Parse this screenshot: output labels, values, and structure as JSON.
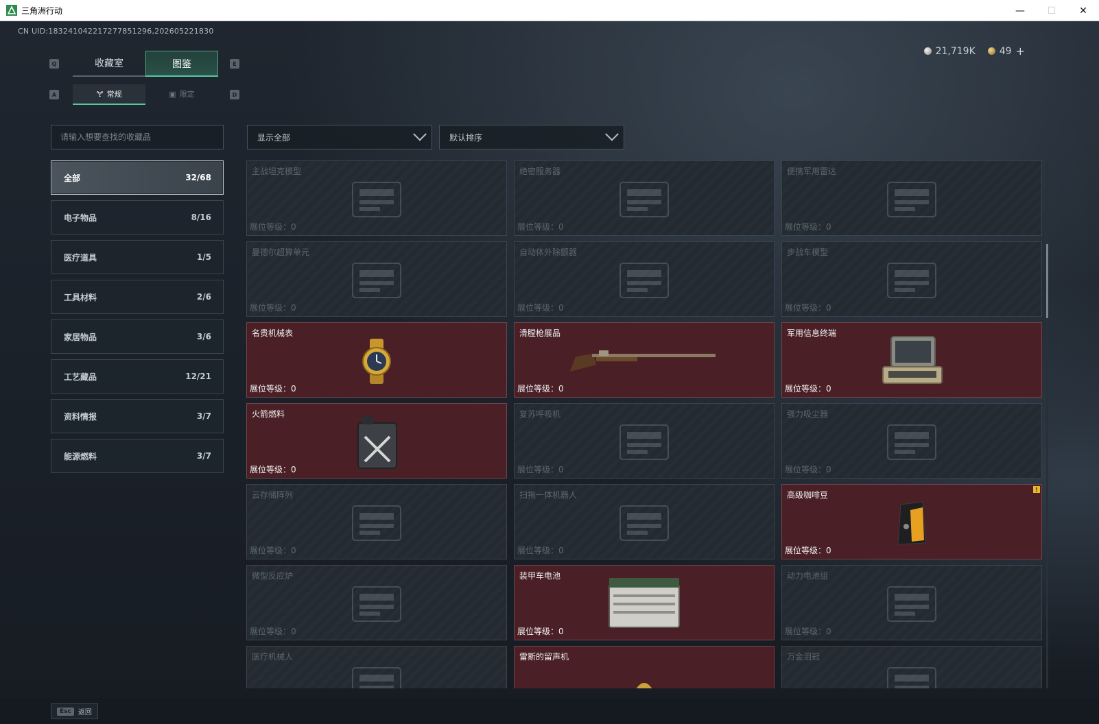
{
  "window": {
    "title": "三角洲行动",
    "minimize": "—",
    "maximize": "☐",
    "close": "✕"
  },
  "uid_text": "CN UID:183241042217277851296,202605221830",
  "currency": {
    "silver": "21,719K",
    "gold": "49",
    "plus": "+"
  },
  "keys": {
    "tab_left": "Q",
    "tab_right": "E",
    "sub_left": "A",
    "sub_right": "D"
  },
  "tabs": [
    {
      "label": "收藏室"
    },
    {
      "label": "图鉴"
    }
  ],
  "subtabs": [
    {
      "label": "常规",
      "icon": "🝖"
    },
    {
      "label": "限定",
      "icon": "▣"
    }
  ],
  "search": {
    "placeholder": "请输入想要查找的收藏品"
  },
  "filter": {
    "label": "显示全部"
  },
  "sort": {
    "label": "默认排序"
  },
  "categories": [
    {
      "label": "全部",
      "count": "32/68"
    },
    {
      "label": "电子物品",
      "count": "8/16"
    },
    {
      "label": "医疗道具",
      "count": "1/5"
    },
    {
      "label": "工具材料",
      "count": "2/6"
    },
    {
      "label": "家居物品",
      "count": "3/6"
    },
    {
      "label": "工艺藏品",
      "count": "12/21"
    },
    {
      "label": "资料情报",
      "count": "3/7"
    },
    {
      "label": "能源燃料",
      "count": "3/7"
    }
  ],
  "level_label": "展位等级：",
  "items": [
    {
      "name": "主战坦克模型",
      "level": "0",
      "owned": false,
      "icon": "tank-model-icon"
    },
    {
      "name": "绝密服务器",
      "level": "0",
      "owned": false,
      "icon": "server-icon"
    },
    {
      "name": "便携军用雷达",
      "level": "0",
      "owned": false,
      "icon": "radar-icon"
    },
    {
      "name": "曼德尔超算单元",
      "level": "0",
      "owned": false,
      "icon": "compute-unit-icon"
    },
    {
      "name": "自动体外除颤器",
      "level": "0",
      "owned": false,
      "icon": "defibrillator-icon"
    },
    {
      "name": "步战车模型",
      "level": "0",
      "owned": false,
      "icon": "ifv-model-icon"
    },
    {
      "name": "名贵机械表",
      "level": "0",
      "owned": true,
      "icon": "watch-icon"
    },
    {
      "name": "滑膛枪展品",
      "level": "0",
      "owned": true,
      "icon": "musket-icon"
    },
    {
      "name": "军用信息终端",
      "level": "0",
      "owned": true,
      "icon": "terminal-icon"
    },
    {
      "name": "火箭燃料",
      "level": "0",
      "owned": true,
      "icon": "fuel-can-icon"
    },
    {
      "name": "复苏呼吸机",
      "level": "0",
      "owned": false,
      "icon": "ventilator-icon"
    },
    {
      "name": "强力吸尘器",
      "level": "0",
      "owned": false,
      "icon": "vacuum-icon"
    },
    {
      "name": "云存储阵列",
      "level": "0",
      "owned": false,
      "icon": "storage-array-icon"
    },
    {
      "name": "扫拖一体机器人",
      "level": "0",
      "owned": false,
      "icon": "robot-icon"
    },
    {
      "name": "高级咖啡豆",
      "level": "0",
      "owned": true,
      "icon": "coffee-bag-icon",
      "badge": "!"
    },
    {
      "name": "微型反应炉",
      "level": "0",
      "owned": false,
      "icon": "reactor-icon"
    },
    {
      "name": "装甲车电池",
      "level": "0",
      "owned": true,
      "icon": "battery-icon"
    },
    {
      "name": "动力电池组",
      "level": "0",
      "owned": false,
      "icon": "battery-pack-icon"
    },
    {
      "name": "医疗机械人",
      "level": "",
      "owned": false,
      "icon": "medical-robot-icon"
    },
    {
      "name": "雷斯的留声机",
      "level": "",
      "owned": true,
      "icon": "gramophone-icon"
    },
    {
      "name": "万金泪冠",
      "level": "",
      "owned": false,
      "icon": "crown-icon"
    }
  ],
  "footer": {
    "esc_key": "Esc",
    "esc_label": "返回"
  }
}
